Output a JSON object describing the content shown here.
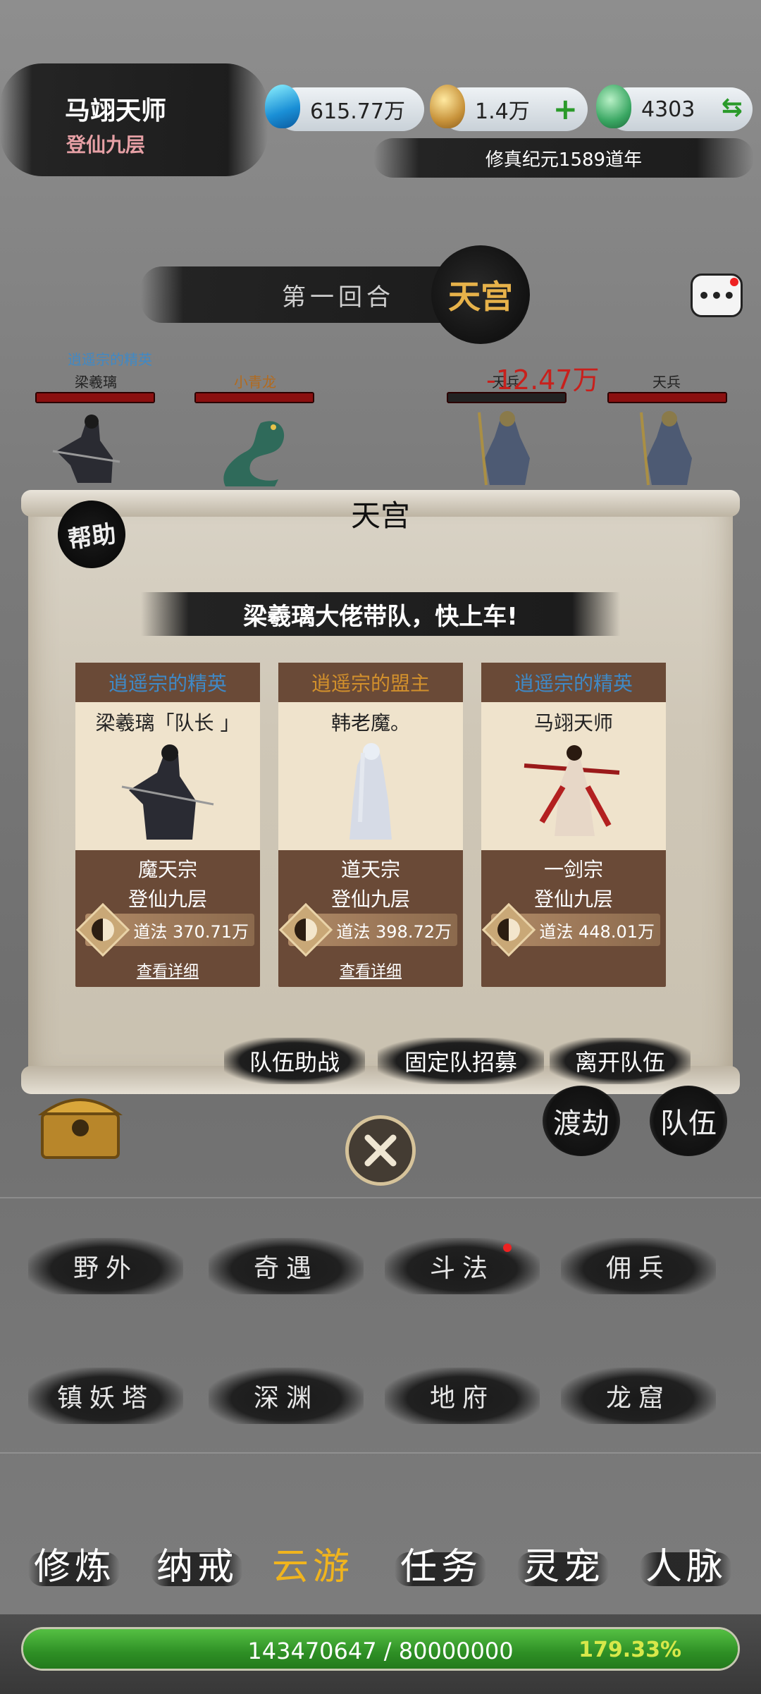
{
  "player": {
    "name": "马翊天师",
    "realm": "登仙九层"
  },
  "resources": [
    {
      "icon": "blue-crystal-icon",
      "value": "615.77万"
    },
    {
      "icon": "gold-gourd-icon",
      "value": "1.4万",
      "action": "+"
    },
    {
      "icon": "jade-gourd-icon",
      "value": "4303",
      "action": "⇆"
    }
  ],
  "era": "修真纪元1589道年",
  "battle": {
    "round": "第一回合",
    "stage": "天宫",
    "allies": [
      {
        "title": "逍遥宗的精英",
        "name": "梁羲璃",
        "hp": 1.0
      },
      {
        "title": "",
        "name": "小青龙",
        "hp": 1.0
      }
    ],
    "enemies": [
      {
        "name": "天兵",
        "hp": 0.0,
        "damage": "-12.47万"
      },
      {
        "name": "天兵",
        "hp": 1.0
      }
    ]
  },
  "modal": {
    "title": "天宫",
    "help_label": "帮助",
    "banner": "梁羲璃大佬带队，快上车!",
    "members": [
      {
        "title": "逍遥宗的精英",
        "title_color": "#3f89c6",
        "name": "梁羲璃「队长 」",
        "sect": "魔天宗",
        "realm": "登仙九层",
        "power_label": "道法",
        "power": "370.71万",
        "detail": "查看详细"
      },
      {
        "title": "逍遥宗的盟主",
        "title_color": "#d2902c",
        "name": "韩老魔。",
        "sect": "道天宗",
        "realm": "登仙九层",
        "power_label": "道法",
        "power": "398.72万",
        "detail": "查看详细"
      },
      {
        "title": "逍遥宗的精英",
        "title_color": "#3f89c6",
        "name": "马翊天师",
        "sect": "一剑宗",
        "realm": "登仙九层",
        "power_label": "道法",
        "power": "448.01万",
        "detail": ""
      }
    ],
    "actions": [
      "队伍助战",
      "固定队招募",
      "离开队伍"
    ]
  },
  "side_buttons": {
    "crossing": "渡劫",
    "team": "队伍"
  },
  "map_buttons": [
    [
      "野外",
      "奇遇",
      "斗法",
      "佣兵"
    ],
    [
      "镇妖塔",
      "深渊",
      "地府",
      "龙窟"
    ]
  ],
  "bottom_nav": [
    "修炼",
    "纳戒",
    "云游",
    "任务",
    "灵宠",
    "人脉"
  ],
  "bottom_nav_active": 2,
  "exp": {
    "text": "143470647 / 80000000",
    "percent": "179.33%",
    "fill": 1.0
  }
}
